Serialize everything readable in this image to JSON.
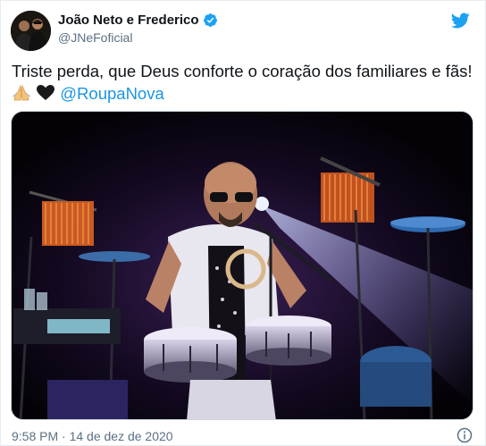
{
  "author": {
    "name": "João Neto e Frederico",
    "handle": "@JNeFoficial"
  },
  "tweet": {
    "text": "Triste perda, que Deus conforte o coração dos familiares e fãs!",
    "emojis": "🙏🖤",
    "mention": "@RoupaNova"
  },
  "footer": {
    "timestamp": "9:58 PM · 14 de dez de 2020"
  },
  "icons": {
    "verified": "verified-badge-icon",
    "brand": "twitter-bird-icon",
    "info": "info-icon"
  },
  "colors": {
    "accent": "#1da1f2",
    "mention": "#1b95e0",
    "secondary_text": "#5b7083"
  }
}
